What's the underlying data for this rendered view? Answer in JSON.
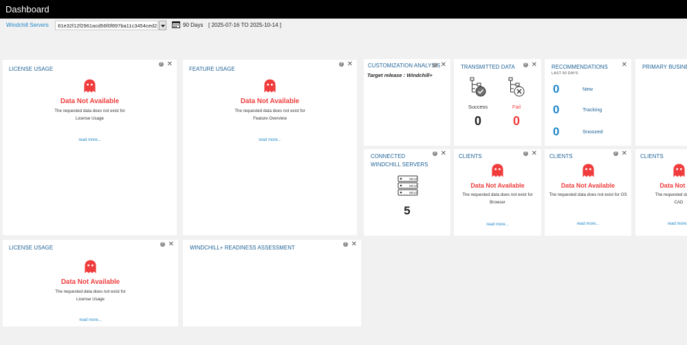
{
  "app": {
    "title": "Dashboard"
  },
  "filter": {
    "server_label": "Windchill Servers",
    "server_value": "81e32f12f2961acd56f0f897ba11c3454ced2...",
    "days": "90 Days",
    "date_range": "[ 2025-07-16 TO 2025-10-14 ]"
  },
  "common": {
    "help_glyph": "?",
    "close_glyph": "✕",
    "no_data_title": "Data Not Available",
    "read_more": "read more..."
  },
  "panels": {
    "license_usage_1": {
      "title": "LICENSE USAGE",
      "desc_line1": "The requested data does not exist for",
      "desc_line2": "License Usage"
    },
    "feature_usage": {
      "title": "FEATURE USAGE",
      "desc_line1": "The requested data does not exist for",
      "desc_line2": "Feature Overview"
    },
    "customization": {
      "title": "CUSTOMIZATION ANALYSIS",
      "subtitle": "Target release : Windchill+"
    },
    "transmitted": {
      "title": "TRANSMITTED DATA",
      "success_label": "Success",
      "success_count": "0",
      "fail_label": "Fail",
      "fail_count": "0"
    },
    "recommendations": {
      "title": "RECOMMENDATIONS",
      "subtitle": "LAST 90 DAYS",
      "rows": [
        {
          "count": "0",
          "label": "New"
        },
        {
          "count": "0",
          "label": "Tracking"
        },
        {
          "count": "0",
          "label": "Snoozed"
        }
      ]
    },
    "primary_business": {
      "title": "PRIMARY BUSINESS"
    },
    "connected_servers": {
      "title_line1": "CONNECTED",
      "title_line2": "WINDCHILL SERVERS",
      "count": "5",
      "server_label": "Winch"
    },
    "clients_browser": {
      "title": "CLIENTS",
      "desc_line1": "The requested data does not exist for",
      "desc_line2": "Browser"
    },
    "clients_os": {
      "title": "CLIENTS",
      "desc_line1": "The requested data does not exist for OS"
    },
    "clients_cad": {
      "title": "CLIENTS",
      "no_data_visible": "Data Not Ava",
      "desc_line1": "The requested data does",
      "desc_line2": "CAD"
    },
    "license_usage_2": {
      "title": "LICENSE USAGE",
      "desc_line1": "The requested data does not exist for",
      "desc_line2": "License Usage"
    },
    "readiness": {
      "title": "WINDCHILL+ READINESS ASSESSMENT"
    }
  },
  "colors": {
    "accent_blue": "#1e86c8",
    "title_blue": "#1a5f94",
    "error_red": "#f03c3c",
    "topbar": "#000000",
    "background": "#f1f1f1"
  },
  "icons": [
    "ghost-icon",
    "help-icon",
    "close-icon",
    "calendar-icon",
    "dropdown-arrow-icon",
    "flow-success-icon",
    "flow-fail-icon",
    "server-stack-icon"
  ]
}
